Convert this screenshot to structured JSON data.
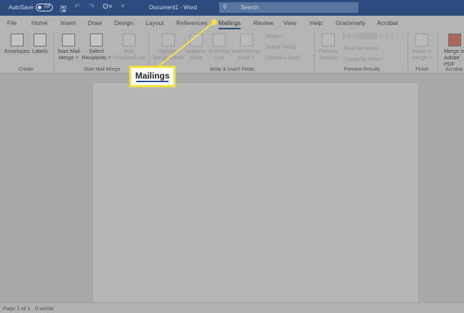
{
  "titlebar": {
    "autosave": "AutoSave",
    "toggle": "Off",
    "doc_title": "Document1 - Word",
    "search_placeholder": "Search"
  },
  "tabs": [
    "File",
    "Home",
    "Insert",
    "Draw",
    "Design",
    "Layout",
    "References",
    "Mailings",
    "Review",
    "View",
    "Help",
    "Grammarly",
    "Acrobat"
  ],
  "active_tab": "Mailings",
  "ribbon": {
    "envelopes": "Envelopes",
    "labels": "Labels",
    "create": "Create",
    "start_mail_merge": "Start Mail Merge ˅",
    "select_recipients": "Select Recipients ˅",
    "edit_recipient_list": "Edit Recipient List",
    "start_group": "Start Mail Merge",
    "highlight": "Highlight Merge Fields",
    "address_block": "Address Block",
    "greeting_line": "Greeting Line",
    "insert_merge_field": "Insert Merge Field ˅",
    "rules": "Rules ˅",
    "match_fields": "Match Fields",
    "update_labels": "Update Labels",
    "write_group": "Write & Insert Fields",
    "preview_results": "Preview Results",
    "find_recipient": "Find Recipient",
    "check_errors": "Check for Errors",
    "preview_group": "Preview Results",
    "finish_merge": "Finish & Merge ˅",
    "finish_group": "Finish",
    "merge_adobe": "Merge to Adobe PDF",
    "acrobat_group": "Acrobat"
  },
  "status": {
    "page": "Page 1 of 1",
    "words": "0 words"
  },
  "callout": {
    "label": "Mailings",
    "color": "#f4e43a"
  }
}
